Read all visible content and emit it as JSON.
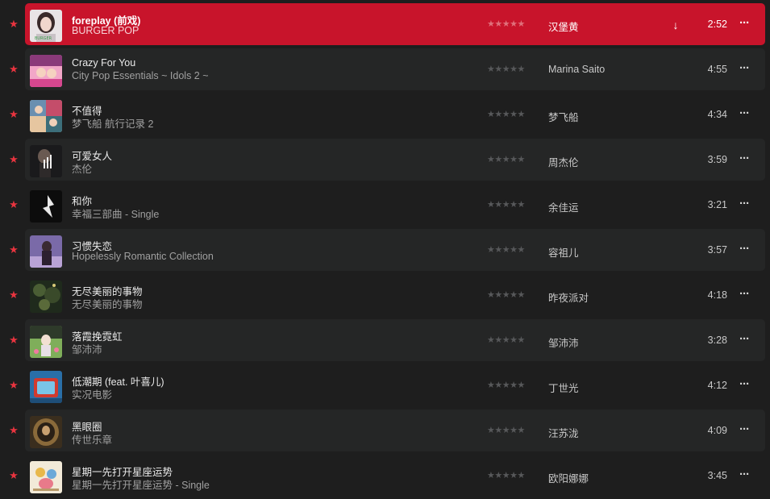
{
  "colors": {
    "background": "#1e1e1e",
    "row_alt": "#252626",
    "playing_highlight": "#c8142b",
    "favorite_star": "#e8343f"
  },
  "icons": {
    "favorite": "★",
    "rating_stars": "★★★★★",
    "download": "↓",
    "more": "···"
  },
  "tracks": [
    {
      "title": "foreplay (前戏)",
      "album": "BURGER POP",
      "artist": "汉堡黄",
      "duration": "2:52",
      "favorite": true,
      "playing": true,
      "downloadable": true
    },
    {
      "title": "Crazy For You",
      "album": "City Pop Essentials ~ Idols 2 ~",
      "artist": "Marina Saito",
      "duration": "4:55",
      "favorite": true,
      "playing": false
    },
    {
      "title": "不值得",
      "album": "梦飞船 航行记录 2",
      "artist": "梦飞船",
      "duration": "4:34",
      "favorite": true,
      "playing": false
    },
    {
      "title": "可爱女人",
      "album": "杰伦",
      "artist": "周杰伦",
      "duration": "3:59",
      "favorite": true,
      "playing": false
    },
    {
      "title": "和你",
      "album": "幸福三部曲 - Single",
      "artist": "余佳运",
      "duration": "3:21",
      "favorite": true,
      "playing": false
    },
    {
      "title": "习惯失恋",
      "album": "Hopelessly Romantic Collection",
      "artist": "容祖儿",
      "duration": "3:57",
      "favorite": true,
      "playing": false
    },
    {
      "title": "无尽美丽的事物",
      "album": "无尽美丽的事物",
      "artist": "昨夜派对",
      "duration": "4:18",
      "favorite": true,
      "playing": false
    },
    {
      "title": "落霞挽霓虹",
      "album": "邹沛沛",
      "artist": "邹沛沛",
      "duration": "3:28",
      "favorite": true,
      "playing": false
    },
    {
      "title": "低潮期 (feat. 叶喜儿)",
      "album": "实况电影",
      "artist": "丁世光",
      "duration": "4:12",
      "favorite": true,
      "playing": false
    },
    {
      "title": "黑眼圈",
      "album": "传世乐章",
      "artist": "汪苏泷",
      "duration": "4:09",
      "favorite": true,
      "playing": false
    },
    {
      "title": "星期一先打开星座运势",
      "album": "星期一先打开星座运势 - Single",
      "artist": "欧阳娜娜",
      "duration": "3:45",
      "favorite": true,
      "playing": false
    }
  ]
}
